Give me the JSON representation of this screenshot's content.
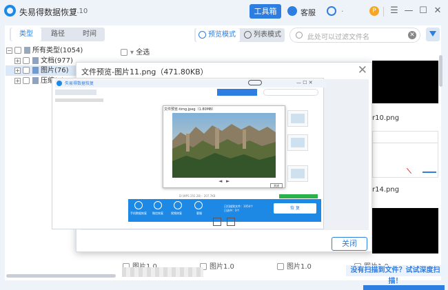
{
  "app": {
    "name": "失易得数据恢复",
    "version": "7.10"
  },
  "header": {
    "toolbox": "工具箱",
    "service": "客服",
    "headset_suffix": "·",
    "coin": "P"
  },
  "window": {
    "minimize": "—",
    "menu": "☰",
    "maximize": "☐",
    "close": "✕"
  },
  "sidebar": {
    "tabs": [
      "类型",
      "路径",
      "时间"
    ],
    "tree": [
      {
        "label": "所有类型(1054)",
        "expander": "−"
      },
      {
        "label": "文档(977)",
        "expander": "+"
      },
      {
        "label": "图片(76)",
        "expander": "+"
      },
      {
        "label": "压缩(1)",
        "expander": "+"
      }
    ]
  },
  "toolbar": {
    "modes": [
      "预览模式",
      "列表模式"
    ],
    "search_placeholder": "此处可以过滤文件名",
    "clear": "✕",
    "select_all": "全选"
  },
  "files": [
    {
      "label": "r10.png"
    },
    {
      "label": "r14.png"
    }
  ],
  "footer": {
    "deep_scan": "没有扫描到文件？试试深度扫描！",
    "items": [
      "图片1.0",
      "图片1.0",
      "图片1.0",
      "图片1.0"
    ]
  },
  "dialog": {
    "title": "文件预览-图片11.png（471.80KB）",
    "close": "✕",
    "ok": "关闭",
    "nested": {
      "app_name": "失易得数据恢复",
      "inner_title": "文件预览-timg.jpeg（1.80MB）",
      "inner_close": "关闭",
      "recover": "恢 复",
      "footer_path": "D:\\WPS 255.2B) - 207.7KB",
      "circle_labels": [
        "手机数据恢复",
        "微信恢复",
        "视频修复",
        "客服"
      ],
      "stats": [
        "已扫描到文件：1054个",
        "已选中：0个"
      ],
      "controls": {
        "prev": "◄",
        "next": "►"
      }
    }
  }
}
